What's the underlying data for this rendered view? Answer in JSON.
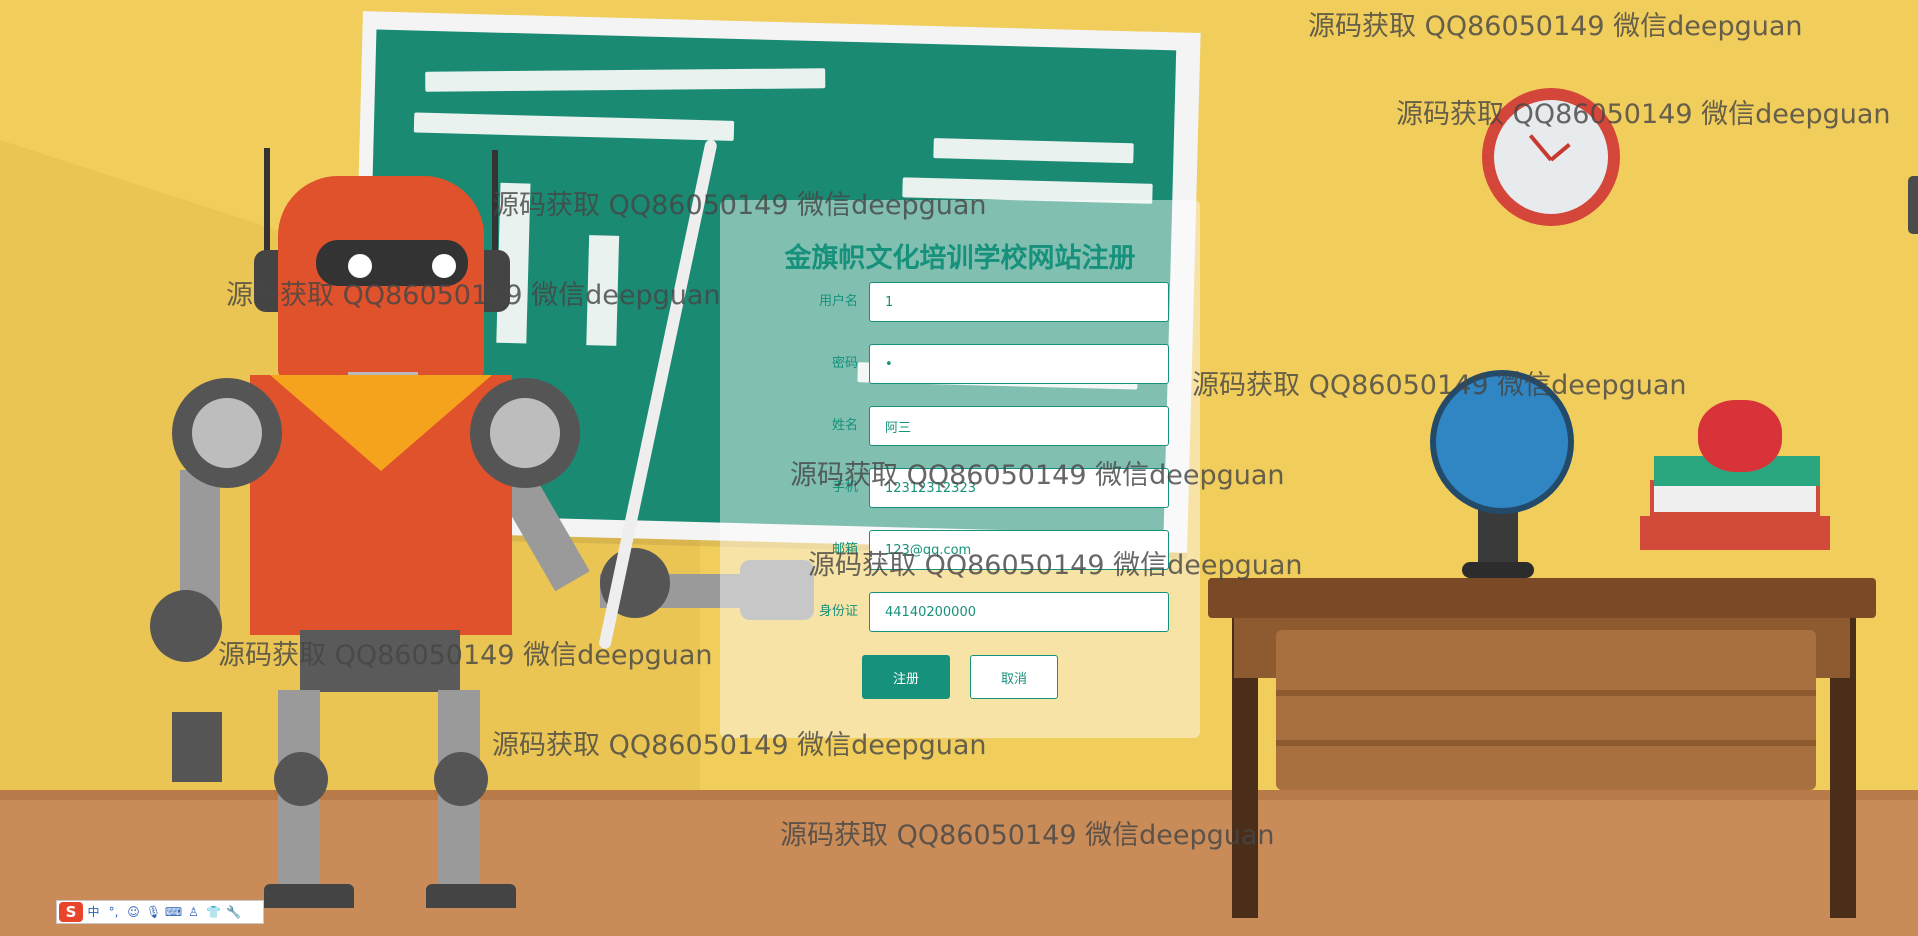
{
  "form": {
    "title": "金旗帜文化培训学校网站注册",
    "fields": [
      {
        "label": "用户名",
        "value": "1",
        "type": "text"
      },
      {
        "label": "密码",
        "value": "•",
        "type": "text"
      },
      {
        "label": "姓名",
        "value": "阿三",
        "type": "text"
      },
      {
        "label": "手机",
        "value": "12312312323",
        "type": "text"
      },
      {
        "label": "邮箱",
        "value": "123@qq.com",
        "type": "text"
      },
      {
        "label": "身份证",
        "value": "44140200000",
        "type": "text"
      }
    ],
    "submit_label": "注册",
    "cancel_label": "取消"
  },
  "watermark_text": "源码获取 QQ86050149 微信deepguan",
  "ime_toolbar": {
    "logo": "S",
    "items": [
      "中",
      "°,",
      "☺",
      "🎙",
      "⌨",
      "♙",
      "👕",
      "🔧"
    ],
    "icon_names": [
      "sogou-logo-icon",
      "chinese-mode-icon",
      "punctuation-icon",
      "emoji-icon",
      "voice-icon",
      "keyboard-icon",
      "user-icon",
      "skin-icon",
      "settings-icon"
    ]
  },
  "colors": {
    "accent": "#16917b",
    "background": "#f1cd5c"
  }
}
